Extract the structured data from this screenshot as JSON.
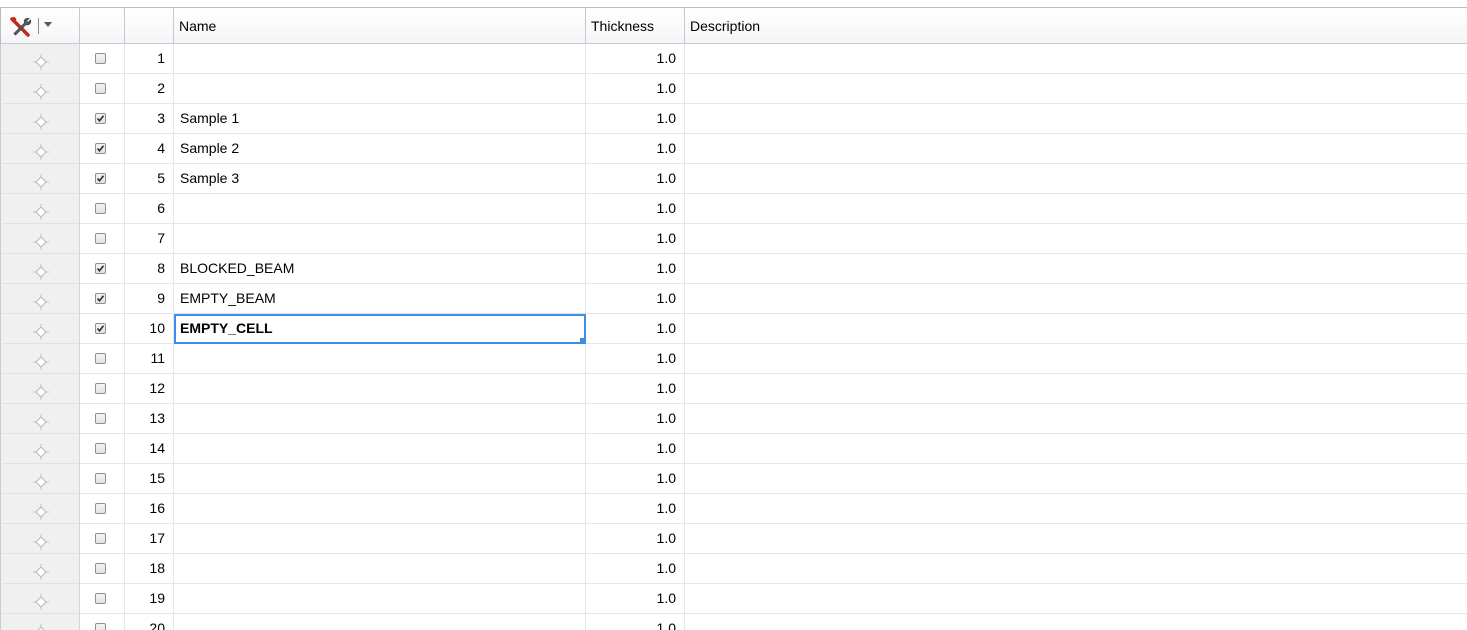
{
  "table": {
    "headers": {
      "tools": "tools-icon",
      "check": "",
      "number": "",
      "name": "Name",
      "thickness": "Thickness",
      "description": "Description"
    },
    "selected_row": 10,
    "rows": [
      {
        "number": "1",
        "checked": false,
        "name": "",
        "thickness": "1.0",
        "description": ""
      },
      {
        "number": "2",
        "checked": false,
        "name": "",
        "thickness": "1.0",
        "description": ""
      },
      {
        "number": "3",
        "checked": true,
        "name": "Sample 1",
        "thickness": "1.0",
        "description": ""
      },
      {
        "number": "4",
        "checked": true,
        "name": "Sample 2",
        "thickness": "1.0",
        "description": ""
      },
      {
        "number": "5",
        "checked": true,
        "name": "Sample 3",
        "thickness": "1.0",
        "description": ""
      },
      {
        "number": "6",
        "checked": false,
        "name": "",
        "thickness": "1.0",
        "description": ""
      },
      {
        "number": "7",
        "checked": false,
        "name": "",
        "thickness": "1.0",
        "description": ""
      },
      {
        "number": "8",
        "checked": true,
        "name": "BLOCKED_BEAM",
        "thickness": "1.0",
        "description": ""
      },
      {
        "number": "9",
        "checked": true,
        "name": "EMPTY_BEAM",
        "thickness": "1.0",
        "description": ""
      },
      {
        "number": "10",
        "checked": true,
        "name": "EMPTY_CELL",
        "thickness": "1.0",
        "description": ""
      },
      {
        "number": "11",
        "checked": false,
        "name": "",
        "thickness": "1.0",
        "description": ""
      },
      {
        "number": "12",
        "checked": false,
        "name": "",
        "thickness": "1.0",
        "description": ""
      },
      {
        "number": "13",
        "checked": false,
        "name": "",
        "thickness": "1.0",
        "description": ""
      },
      {
        "number": "14",
        "checked": false,
        "name": "",
        "thickness": "1.0",
        "description": ""
      },
      {
        "number": "15",
        "checked": false,
        "name": "",
        "thickness": "1.0",
        "description": ""
      },
      {
        "number": "16",
        "checked": false,
        "name": "",
        "thickness": "1.0",
        "description": ""
      },
      {
        "number": "17",
        "checked": false,
        "name": "",
        "thickness": "1.0",
        "description": ""
      },
      {
        "number": "18",
        "checked": false,
        "name": "",
        "thickness": "1.0",
        "description": ""
      },
      {
        "number": "19",
        "checked": false,
        "name": "",
        "thickness": "1.0",
        "description": ""
      },
      {
        "number": "20",
        "checked": false,
        "name": "",
        "thickness": "1.0",
        "description": ""
      }
    ]
  },
  "colors": {
    "selection": "#3c8fe8",
    "tool_column_bg": "#f0f0f0",
    "grid_line": "#e3e6ea"
  },
  "icons": {
    "row_handle": "crosshair-icon",
    "tools": "wrench-screwdriver-icon",
    "dropdown": "chevron-down-icon"
  }
}
